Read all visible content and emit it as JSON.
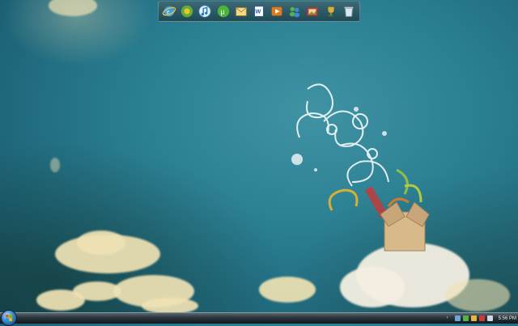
{
  "dock": {
    "items": [
      {
        "name": "internet-explorer",
        "icon": "ie-icon"
      },
      {
        "name": "games",
        "icon": "games-icon"
      },
      {
        "name": "itunes",
        "icon": "itunes-icon"
      },
      {
        "name": "utorrent",
        "icon": "utorrent-icon"
      },
      {
        "name": "outlook",
        "icon": "mail-icon"
      },
      {
        "name": "word",
        "icon": "word-icon"
      },
      {
        "name": "media-player",
        "icon": "media-player-icon"
      },
      {
        "name": "messenger",
        "icon": "messenger-icon"
      },
      {
        "name": "photo",
        "icon": "photo-icon"
      },
      {
        "name": "trophy",
        "icon": "trophy-icon"
      },
      {
        "name": "recycle-bin",
        "icon": "recycle-bin-icon"
      }
    ]
  },
  "taskbar": {
    "start_icon": "windows-orb-icon",
    "clock": "5:56 PM"
  }
}
